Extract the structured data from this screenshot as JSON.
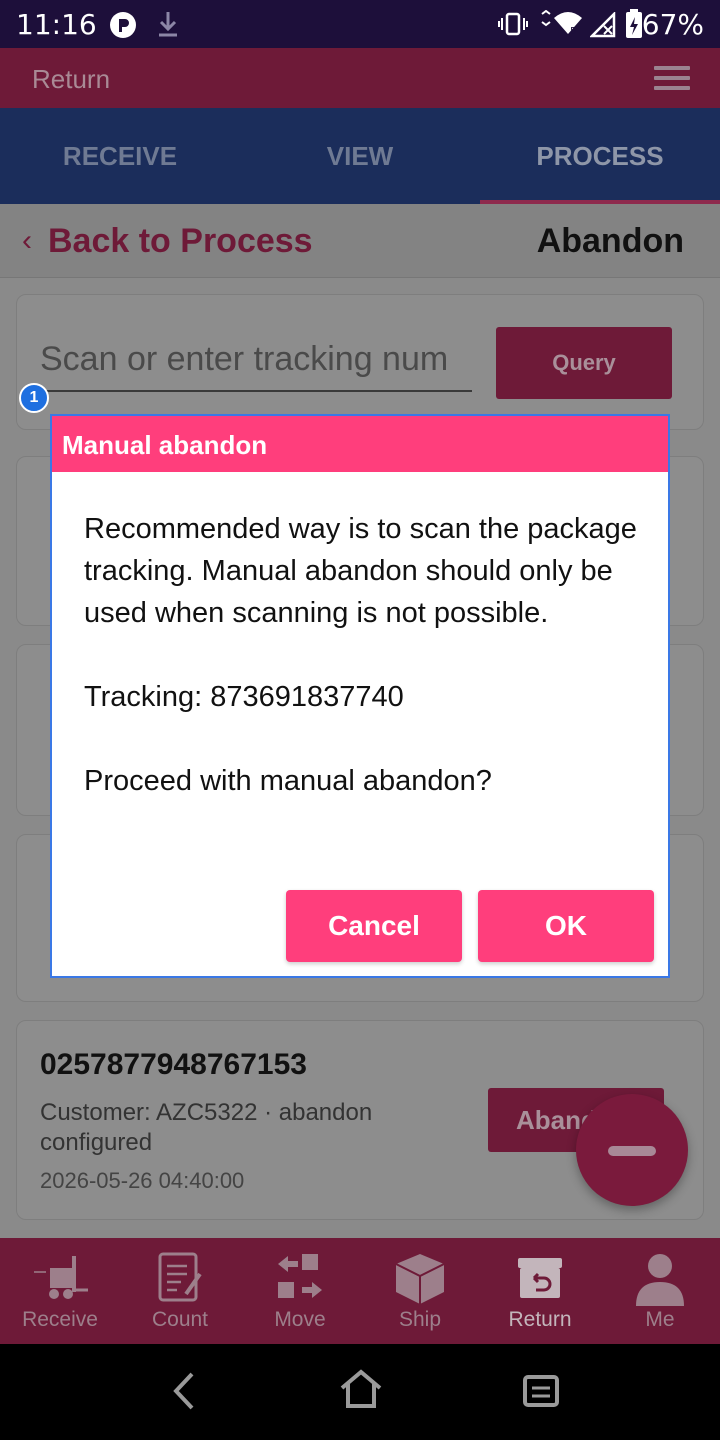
{
  "status_bar": {
    "time": "11:16",
    "battery": "67%"
  },
  "app": {
    "title": "Return"
  },
  "tabs": [
    {
      "label": "RECEIVE"
    },
    {
      "label": "VIEW"
    },
    {
      "label": "PROCESS",
      "active": true
    }
  ],
  "subheader": {
    "back_label": "Back to Process",
    "page_title": "Abandon"
  },
  "search": {
    "placeholder": "Scan or enter tracking num",
    "query_label": "Query"
  },
  "badge": "1",
  "last_card": {
    "tracking": "0257877948767153",
    "customer": "Customer: AZC5322 · abandon configured",
    "date": "2026-05-26 04:40:00",
    "button_label": "Abandon"
  },
  "dialog": {
    "title": "Manual abandon",
    "message": "Recommended way is to scan the package tracking. Manual abandon should only be used when scanning is not possible.",
    "tracking_line": "Tracking: 873691837740",
    "prompt": "Proceed with manual abandon?",
    "cancel_label": "Cancel",
    "ok_label": "OK"
  },
  "bottom_nav": [
    {
      "label": "Receive",
      "icon": "forklift-icon"
    },
    {
      "label": "Count",
      "icon": "clipboard-icon"
    },
    {
      "label": "Move",
      "icon": "move-arrows-icon"
    },
    {
      "label": "Ship",
      "icon": "box-icon"
    },
    {
      "label": "Return",
      "icon": "return-box-icon",
      "active": true
    },
    {
      "label": "Me",
      "icon": "person-icon"
    }
  ],
  "colors": {
    "brand": "#e8336f",
    "dialog_accent": "#ff3e7c",
    "tab_bar": "#1b2d5b"
  }
}
